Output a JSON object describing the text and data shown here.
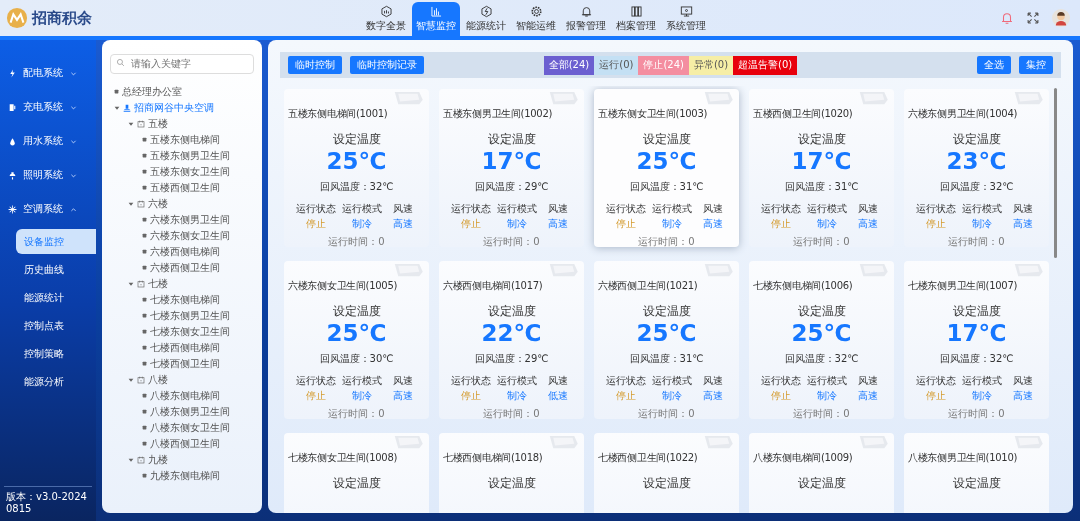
{
  "header": {
    "logo_text": "招商积余",
    "nav": [
      {
        "label": "数字全景",
        "selected": false
      },
      {
        "label": "智慧监控",
        "selected": true
      },
      {
        "label": "能源统计",
        "selected": false
      },
      {
        "label": "智能运维",
        "selected": false
      },
      {
        "label": "报警管理",
        "selected": false
      },
      {
        "label": "档案管理",
        "selected": false
      },
      {
        "label": "系统管理",
        "selected": false
      }
    ]
  },
  "sidebar": {
    "items": [
      {
        "label": "配电系统",
        "expanded": false
      },
      {
        "label": "充电系统",
        "expanded": false
      },
      {
        "label": "用水系统",
        "expanded": false
      },
      {
        "label": "照明系统",
        "expanded": false
      },
      {
        "label": "空调系统",
        "expanded": true,
        "children": [
          {
            "label": "设备监控",
            "selected": true
          },
          {
            "label": "历史曲线",
            "selected": false
          },
          {
            "label": "能源统计",
            "selected": false
          },
          {
            "label": "控制点表",
            "selected": false
          },
          {
            "label": "控制策略",
            "selected": false
          },
          {
            "label": "能源分析",
            "selected": false
          }
        ]
      }
    ],
    "version": "版本：v3.0-20240815"
  },
  "tree": {
    "placeholder": "请输入关键字",
    "items": [
      {
        "label": "总经理办公室",
        "kind": "leaf",
        "selected": false
      },
      {
        "label": "招商网谷中央空调",
        "kind": "root",
        "selected": true,
        "expanded": true,
        "children": [
          {
            "label": "五楼",
            "kind": "floor",
            "expanded": true,
            "children": [
              {
                "label": "五楼东侧电梯间",
                "kind": "leaf"
              },
              {
                "label": "五楼东侧男卫生间",
                "kind": "leaf"
              },
              {
                "label": "五楼东侧女卫生间",
                "kind": "leaf"
              },
              {
                "label": "五楼西侧卫生间",
                "kind": "leaf"
              }
            ]
          },
          {
            "label": "六楼",
            "kind": "floor",
            "expanded": true,
            "children": [
              {
                "label": "六楼东侧男卫生间",
                "kind": "leaf"
              },
              {
                "label": "六楼东侧女卫生间",
                "kind": "leaf"
              },
              {
                "label": "六楼西侧电梯间",
                "kind": "leaf"
              },
              {
                "label": "六楼西侧卫生间",
                "kind": "leaf"
              }
            ]
          },
          {
            "label": "七楼",
            "kind": "floor",
            "expanded": true,
            "children": [
              {
                "label": "七楼东侧电梯间",
                "kind": "leaf"
              },
              {
                "label": "七楼东侧男卫生间",
                "kind": "leaf"
              },
              {
                "label": "七楼东侧女卫生间",
                "kind": "leaf"
              },
              {
                "label": "七楼西侧电梯间",
                "kind": "leaf"
              },
              {
                "label": "七楼西侧卫生间",
                "kind": "leaf"
              }
            ]
          },
          {
            "label": "八楼",
            "kind": "floor",
            "expanded": true,
            "children": [
              {
                "label": "八楼东侧电梯间",
                "kind": "leaf"
              },
              {
                "label": "八楼东侧男卫生间",
                "kind": "leaf"
              },
              {
                "label": "八楼东侧女卫生间",
                "kind": "leaf"
              },
              {
                "label": "八楼西侧卫生间",
                "kind": "leaf"
              }
            ]
          },
          {
            "label": "九楼",
            "kind": "floor",
            "expanded": true,
            "children": [
              {
                "label": "九楼东侧电梯间",
                "kind": "leaf"
              }
            ]
          }
        ]
      }
    ]
  },
  "toolbar": {
    "left_buttons": [
      "临时控制",
      "临时控制记录"
    ],
    "filters": [
      {
        "label": "全部(24)",
        "color": "#6b5fd0"
      },
      {
        "label": "运行(0)",
        "color": "#c4e0f4"
      },
      {
        "label": "停止(24)",
        "color": "#f48ea0"
      },
      {
        "label": "异常(0)",
        "color": "#f6eea6"
      },
      {
        "label": "超温告警(0)",
        "color": "#e8000c"
      }
    ],
    "right_buttons": [
      "全选",
      "集控"
    ]
  },
  "cards": [
    {
      "name": "五楼东侧电梯间(1001)",
      "set_label": "设定温度",
      "set_temp": "25℃",
      "return": "回风温度：32℃",
      "fields": [
        {
          "label": "运行状态",
          "value": "停止",
          "kind": "status"
        },
        {
          "label": "运行模式",
          "value": "制冷",
          "kind": "mode"
        },
        {
          "label": "风速",
          "value": "高速",
          "kind": "speed"
        }
      ],
      "runtime": "运行时间：0",
      "selected": false
    },
    {
      "name": "五楼东侧男卫生间(1002)",
      "set_label": "设定温度",
      "set_temp": "17℃",
      "return": "回风温度：29℃",
      "fields": [
        {
          "label": "运行状态",
          "value": "停止",
          "kind": "status"
        },
        {
          "label": "运行模式",
          "value": "制冷",
          "kind": "mode"
        },
        {
          "label": "风速",
          "value": "高速",
          "kind": "speed"
        }
      ],
      "runtime": "运行时间：0",
      "selected": false
    },
    {
      "name": "五楼东侧女卫生间(1003)",
      "set_label": "设定温度",
      "set_temp": "25℃",
      "return": "回风温度：31℃",
      "fields": [
        {
          "label": "运行状态",
          "value": "停止",
          "kind": "status"
        },
        {
          "label": "运行模式",
          "value": "制冷",
          "kind": "mode"
        },
        {
          "label": "风速",
          "value": "高速",
          "kind": "speed"
        }
      ],
      "runtime": "运行时间：0",
      "selected": true
    },
    {
      "name": "五楼西侧卫生间(1020)",
      "set_label": "设定温度",
      "set_temp": "17℃",
      "return": "回风温度：31℃",
      "fields": [
        {
          "label": "运行状态",
          "value": "停止",
          "kind": "status"
        },
        {
          "label": "运行模式",
          "value": "制冷",
          "kind": "mode"
        },
        {
          "label": "风速",
          "value": "高速",
          "kind": "speed"
        }
      ],
      "runtime": "运行时间：0",
      "selected": false
    },
    {
      "name": "六楼东侧男卫生间(1004)",
      "set_label": "设定温度",
      "set_temp": "23℃",
      "return": "回风温度：32℃",
      "fields": [
        {
          "label": "运行状态",
          "value": "停止",
          "kind": "status"
        },
        {
          "label": "运行模式",
          "value": "制冷",
          "kind": "mode"
        },
        {
          "label": "风速",
          "value": "高速",
          "kind": "speed"
        }
      ],
      "runtime": "运行时间：0",
      "selected": false
    },
    {
      "name": "六楼东侧女卫生间(1005)",
      "set_label": "设定温度",
      "set_temp": "25℃",
      "return": "回风温度：30℃",
      "fields": [
        {
          "label": "运行状态",
          "value": "停止",
          "kind": "status"
        },
        {
          "label": "运行模式",
          "value": "制冷",
          "kind": "mode"
        },
        {
          "label": "风速",
          "value": "高速",
          "kind": "speed"
        }
      ],
      "runtime": "运行时间：0",
      "selected": false
    },
    {
      "name": "六楼西侧电梯间(1017)",
      "set_label": "设定温度",
      "set_temp": "22℃",
      "return": "回风温度：29℃",
      "fields": [
        {
          "label": "运行状态",
          "value": "停止",
          "kind": "status"
        },
        {
          "label": "运行模式",
          "value": "制冷",
          "kind": "mode"
        },
        {
          "label": "风速",
          "value": "低速",
          "kind": "speed"
        }
      ],
      "runtime": "运行时间：0",
      "selected": false
    },
    {
      "name": "六楼西侧卫生间(1021)",
      "set_label": "设定温度",
      "set_temp": "25℃",
      "return": "回风温度：31℃",
      "fields": [
        {
          "label": "运行状态",
          "value": "停止",
          "kind": "status"
        },
        {
          "label": "运行模式",
          "value": "制冷",
          "kind": "mode"
        },
        {
          "label": "风速",
          "value": "高速",
          "kind": "speed"
        }
      ],
      "runtime": "运行时间：0",
      "selected": false
    },
    {
      "name": "七楼东侧电梯间(1006)",
      "set_label": "设定温度",
      "set_temp": "25℃",
      "return": "回风温度：32℃",
      "fields": [
        {
          "label": "运行状态",
          "value": "停止",
          "kind": "status"
        },
        {
          "label": "运行模式",
          "value": "制冷",
          "kind": "mode"
        },
        {
          "label": "风速",
          "value": "高速",
          "kind": "speed"
        }
      ],
      "runtime": "运行时间：0",
      "selected": false
    },
    {
      "name": "七楼东侧男卫生间(1007)",
      "set_label": "设定温度",
      "set_temp": "17℃",
      "return": "回风温度：32℃",
      "fields": [
        {
          "label": "运行状态",
          "value": "停止",
          "kind": "status"
        },
        {
          "label": "运行模式",
          "value": "制冷",
          "kind": "mode"
        },
        {
          "label": "风速",
          "value": "高速",
          "kind": "speed"
        }
      ],
      "runtime": "运行时间：0",
      "selected": false
    },
    {
      "name": "七楼东侧女卫生间(1008)",
      "set_label": "设定温度",
      "selected": false
    },
    {
      "name": "七楼西侧电梯间(1018)",
      "set_label": "设定温度",
      "selected": false
    },
    {
      "name": "七楼西侧卫生间(1022)",
      "set_label": "设定温度",
      "selected": false
    },
    {
      "name": "八楼东侧电梯间(1009)",
      "set_label": "设定温度",
      "selected": false
    },
    {
      "name": "八楼东侧男卫生间(1010)",
      "set_label": "设定温度",
      "selected": false
    }
  ]
}
